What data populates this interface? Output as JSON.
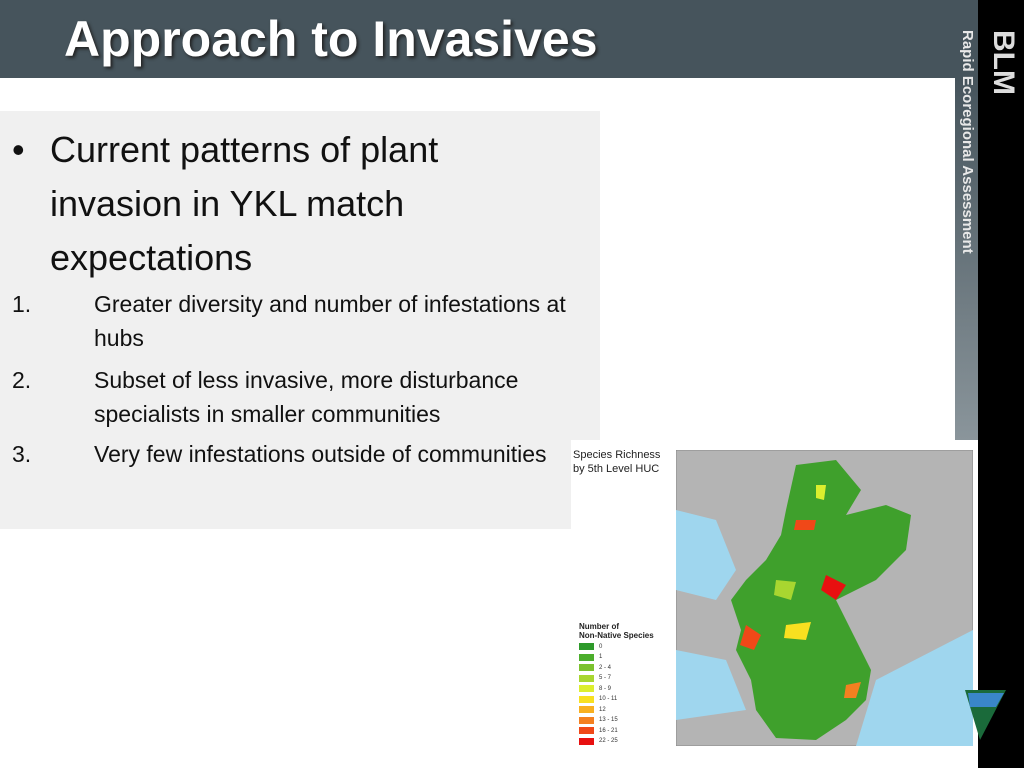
{
  "slide": {
    "title": "Approach to Invasives"
  },
  "sidebar": {
    "brand": "BLM",
    "subtitle": "Rapid Ecoregional Assessment"
  },
  "content": {
    "bullet": "Current patterns of plant invasion in YKL match expectations",
    "items": [
      {
        "num": "1.",
        "text": "Greater diversity and number of infestations at hubs"
      },
      {
        "num": "2.",
        "text": "Subset of less invasive, more disturbance specialists in smaller communities"
      },
      {
        "num": "3.",
        "text": "Very few infestations outside of communities"
      }
    ]
  },
  "map": {
    "title_line1": "Species Richness",
    "title_line2": "by 5th Level HUC",
    "legend_title_line1": "Number of",
    "legend_title_line2": "Non-Native Species",
    "legend": [
      {
        "label": "0",
        "color": "#2e9a2a"
      },
      {
        "label": "1",
        "color": "#4cae2c"
      },
      {
        "label": "2 - 4",
        "color": "#7cc22e"
      },
      {
        "label": "5 - 7",
        "color": "#a8d630"
      },
      {
        "label": "8 - 9",
        "color": "#dcee2e"
      },
      {
        "label": "10 - 11",
        "color": "#f8e020"
      },
      {
        "label": "12",
        "color": "#f8b020"
      },
      {
        "label": "13 - 15",
        "color": "#f48020"
      },
      {
        "label": "16 - 21",
        "color": "#f04818"
      },
      {
        "label": "22 - 25",
        "color": "#e81010"
      }
    ]
  }
}
